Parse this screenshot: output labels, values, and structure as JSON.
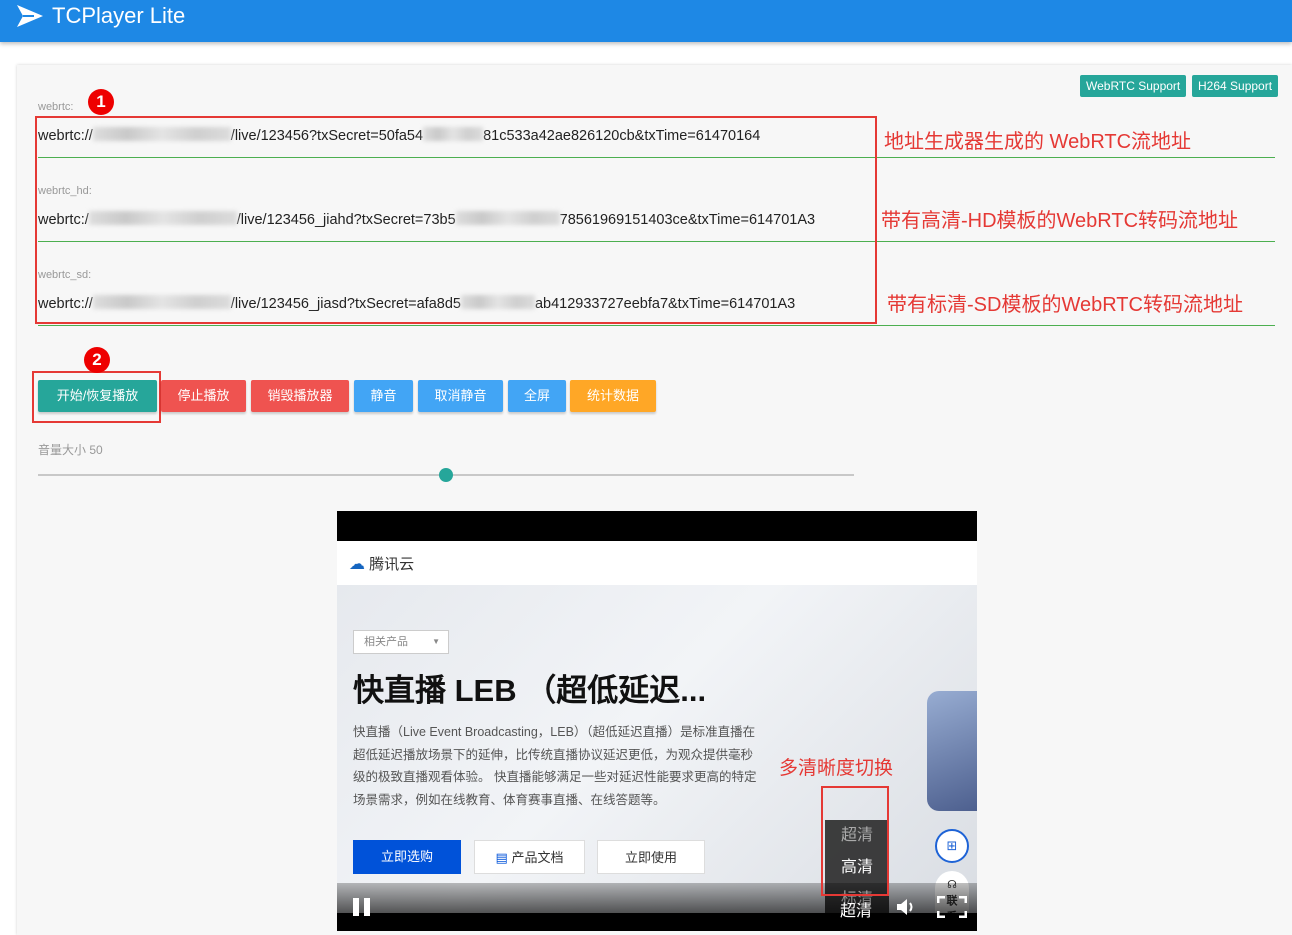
{
  "appbar": {
    "title": "TCPlayer Lite"
  },
  "badges": {
    "webrtc": "WebRTC Support",
    "h264": "H264 Support"
  },
  "fields": [
    {
      "label": "webrtc:",
      "prefix": "webrtc://",
      "mid": "/live/123456?txSecret=50fa54",
      "suffix": "81c533a42ae826120cb&txTime=61470164"
    },
    {
      "label": "webrtc_hd:",
      "prefix": "webrtc:/",
      "mid": "/live/123456_jiahd?txSecret=73b5",
      "suffix": "78561969151403ce&txTime=614701A3"
    },
    {
      "label": "webrtc_sd:",
      "prefix": "webrtc://",
      "mid": "/live/123456_jiasd?txSecret=afa8d5",
      "suffix": "ab412933727eebfa7&txTime=614701A3"
    }
  ],
  "annotations": {
    "a1": "地址生成器生成的 WebRTC流地址",
    "a2": "带有高清-HD模板的WebRTC转码流地址",
    "a3": "带有标清-SD模板的WebRTC转码流地址",
    "quality": "多清晰度切换",
    "num1": "1",
    "num2": "2"
  },
  "buttons": [
    {
      "label": "开始/恢复播放",
      "color": "#26a69a"
    },
    {
      "label": "停止播放",
      "color": "#ef5350"
    },
    {
      "label": "销毁播放器",
      "color": "#ef5350"
    },
    {
      "label": "静音",
      "color": "#42a5f5"
    },
    {
      "label": "取消静音",
      "color": "#42a5f5"
    },
    {
      "label": "全屏",
      "color": "#42a5f5"
    },
    {
      "label": "统计数据",
      "color": "#ffa726"
    }
  ],
  "volume": {
    "label": "音量大小 50",
    "value": 50,
    "max": 100
  },
  "player": {
    "brand": "腾讯云",
    "product_tag": "相关产品",
    "headline": "快直播 LEB （超低延迟...",
    "paragraph": "快直播（Live Event Broadcasting，LEB）（超低延迟直播）是标准直播在超低延迟播放场景下的延伸，比传统直播协议延迟更低，为观众提供毫秒级的极致直播观看体验。 快直播能够满足一些对延迟性能要求更高的特定场景需求，例如在线教育、体育赛事直播、在线答题等。",
    "btn_buy": "立即选购",
    "btn_docs": "产品文档",
    "btn_use": "立即使用",
    "side_contact": "联系",
    "quality_options": [
      "超清",
      "高清",
      "标清"
    ],
    "current_quality": "超清"
  }
}
